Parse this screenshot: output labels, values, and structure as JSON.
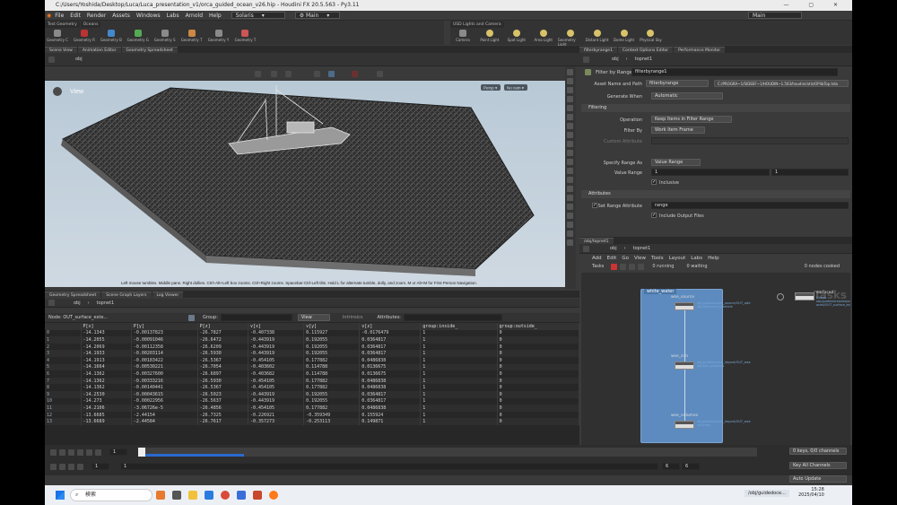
{
  "window": {
    "title": "C:/Users/Yoshida/Desktop/Luca/Luca_presentation_v1/orca_guided_ocean_v26.hip - Houdini FX 20.5.563 - Py3.11",
    "controls": "—  ▢  ✕"
  },
  "menu": {
    "items": [
      "File",
      "Edit",
      "Render",
      "Assets",
      "Windows",
      "Labs",
      "Arnold",
      "Help"
    ],
    "desktop": "Solaris",
    "pane": "Main",
    "right_desktop": "Main"
  },
  "shelf_left": {
    "tabs": [
      "Test Geometry",
      "Oceans"
    ],
    "tools": [
      "Geometry C",
      "Geometry R",
      "Geometry B",
      "Geometry G",
      "Geometry S",
      "Geometry T",
      "Geometry Y",
      "Geometry T"
    ]
  },
  "shelf_right": {
    "tabs": [
      "USD Lights and Camera"
    ],
    "tools": [
      "Camera",
      "Point Light",
      "Spot Light",
      "Area Light",
      "Geometry Light",
      "Distant Light",
      "Dome Light",
      "Physical Sky"
    ]
  },
  "left_tabs": [
    "Scene View",
    "Animation Editor",
    "Geometry Spreadsheet"
  ],
  "right_tabs": [
    "filterbyrange1",
    "Context Options Editor",
    "Performance Monitor"
  ],
  "viewport": {
    "path": "obj",
    "label": "View",
    "persp": "Persp ▾",
    "cam": "No cam ▾",
    "hint": "Left mouse tumbles. Middle pans. Right dollies. Ctrl+Alt+Left box zooms. Ctrl+Right zooms. Spacebar-Ctrl-Left tilts. Hold L for alternate tumble, dolly, and zoom.   M or Alt+M for First Person Navigation."
  },
  "params": {
    "path_a": "obj",
    "path_b": "topnet1",
    "node_type": "Filter by Range",
    "node_name": "filterbyrange1",
    "asset_label": "Asset Name and Path",
    "asset_name": "filterbyrange",
    "asset_path": "C:/PROGRA~1/SIDEEF~1/HOUDIN~1.563/houdini/otls/OPlibTop.hda",
    "generate_label": "Generate When",
    "generate_value": "Automatic",
    "filtering": "Filtering",
    "op_label": "Operation",
    "op_value": "Keep Items in Filter Range",
    "filterby_label": "Filter By",
    "filterby_value": "Work Item Frame",
    "custom_label": "Custom Attribute",
    "specify_label": "Specify Range As",
    "specify_value": "Value Range",
    "range_label": "Value Range",
    "range_from": "1",
    "range_to": "1",
    "inclusive": "Inclusive",
    "attributes": "Attributes",
    "setrange_label": "Set Range Attribute",
    "setrange_value": "range",
    "include_output": "Include Output Files"
  },
  "spreadsheet": {
    "tabs": [
      "Geometry Spreadsheet",
      "Scene Graph Layers",
      "Log Viewer"
    ],
    "path_a": "obj",
    "path_b": "topnet1",
    "node_label": "Node: OUT_surface_exte...",
    "group_label": "Group:",
    "view": "View",
    "intrinsics": "Intrinsics",
    "attributes": "Attributes:",
    "columns": [
      "",
      "P[x]",
      "P[y]",
      "P[z]",
      "v[x]",
      "v[y]",
      "v[z]",
      "group:inside_",
      "group:outside_"
    ],
    "rows": [
      [
        "0",
        "-14.1343",
        "-0.00137823",
        "-26.7827",
        "-0.407338",
        "0.115927",
        "-0.0176479",
        "1",
        "0"
      ],
      [
        "1",
        "-14.2055",
        "-0.00091046",
        "-26.6472",
        "-0.443919",
        "0.192055",
        "0.0364817",
        "1",
        "0"
      ],
      [
        "2",
        "-14.2069",
        "-0.00112358",
        "-26.6209",
        "-0.443919",
        "0.192055",
        "0.0364817",
        "1",
        "0"
      ],
      [
        "3",
        "-14.1933",
        "-0.00203114",
        "-26.5930",
        "-0.443919",
        "0.192055",
        "0.0364817",
        "1",
        "0"
      ],
      [
        "4",
        "-14.1913",
        "-0.00183422",
        "-26.5367",
        "-0.454105",
        "0.177882",
        "0.0486838",
        "1",
        "0"
      ],
      [
        "5",
        "-14.1664",
        "-0.00530221",
        "-26.7054",
        "-0.403602",
        "0.114788",
        "0.0136675",
        "1",
        "0"
      ],
      [
        "6",
        "-14.1362",
        "-0.00327600",
        "-26.6897",
        "-0.403682",
        "0.114788",
        "0.0136675",
        "1",
        "0"
      ],
      [
        "7",
        "-14.1362",
        "-0.00333216",
        "-26.5930",
        "-0.454105",
        "0.177882",
        "0.0486838",
        "1",
        "0"
      ],
      [
        "8",
        "-14.1362",
        "-0.00140441",
        "-26.5367",
        "-0.454105",
        "0.177882",
        "0.0486838",
        "1",
        "0"
      ],
      [
        "9",
        "-14.2530",
        "-0.00043615",
        "-26.5023",
        "-0.443919",
        "0.192055",
        "0.0364817",
        "1",
        "0"
      ],
      [
        "10",
        "-14.273",
        "-0.00022956",
        "-26.5637",
        "-0.443919",
        "0.192055",
        "0.0364817",
        "1",
        "0"
      ],
      [
        "11",
        "-14.2106",
        "-3.06726e-5",
        "-26.4856",
        "-0.454105",
        "0.177882",
        "0.0486838",
        "1",
        "0"
      ],
      [
        "12",
        "-13.6685",
        "-2.44154",
        "-26.7325",
        "-0.226921",
        "-0.359349",
        "0.155924",
        "1",
        "0"
      ],
      [
        "13",
        "-13.6689",
        "-2.44584",
        "-26.7617",
        "-0.357273",
        "-0.253113",
        "0.149871",
        "1",
        "0"
      ]
    ]
  },
  "network": {
    "tabs": [
      "/obj/topnet1"
    ],
    "path_a": "obj",
    "path_b": "topnet1",
    "menu": [
      "Add",
      "Edit",
      "Go",
      "View",
      "Tools",
      "Layout",
      "Labs",
      "Help"
    ],
    "tasks": "Tasks",
    "running": "0 running",
    "waiting": "0 waiting",
    "cooked": "0 nodes cooked",
    "watermark": "Tasks",
    "box_label": "white_water",
    "nodes": [
      {
        "name": "wse_source",
        "info": "obj/guidedocean_source/OUT_add\nobj/obj/source_particle"
      },
      {
        "name": "wse_sim",
        "info": "obj/guidedocean_import/OUT_wse\nobj/wse_particles"
      },
      {
        "name": "wse_volumes",
        "info": "obj/guidedocean_import/OUT_wse\nvolumes"
      },
      {
        "name": "surfaced",
        "info": "Ocean\nobj/guidedoceanexport_fluid_surf\naced/OUT_surface_extended"
      }
    ]
  },
  "timeline": {
    "frame": "1",
    "start": "1",
    "start2": "1",
    "end": "6",
    "end2": "6",
    "keys": "0 keys, 0/0 channels",
    "keyall": "Key All Channels",
    "auto": "Auto Update"
  },
  "taskbar": {
    "search": "検索",
    "tab_label": "/obj/guidedoce...",
    "time": "15:28",
    "date": "2025/04/10"
  }
}
